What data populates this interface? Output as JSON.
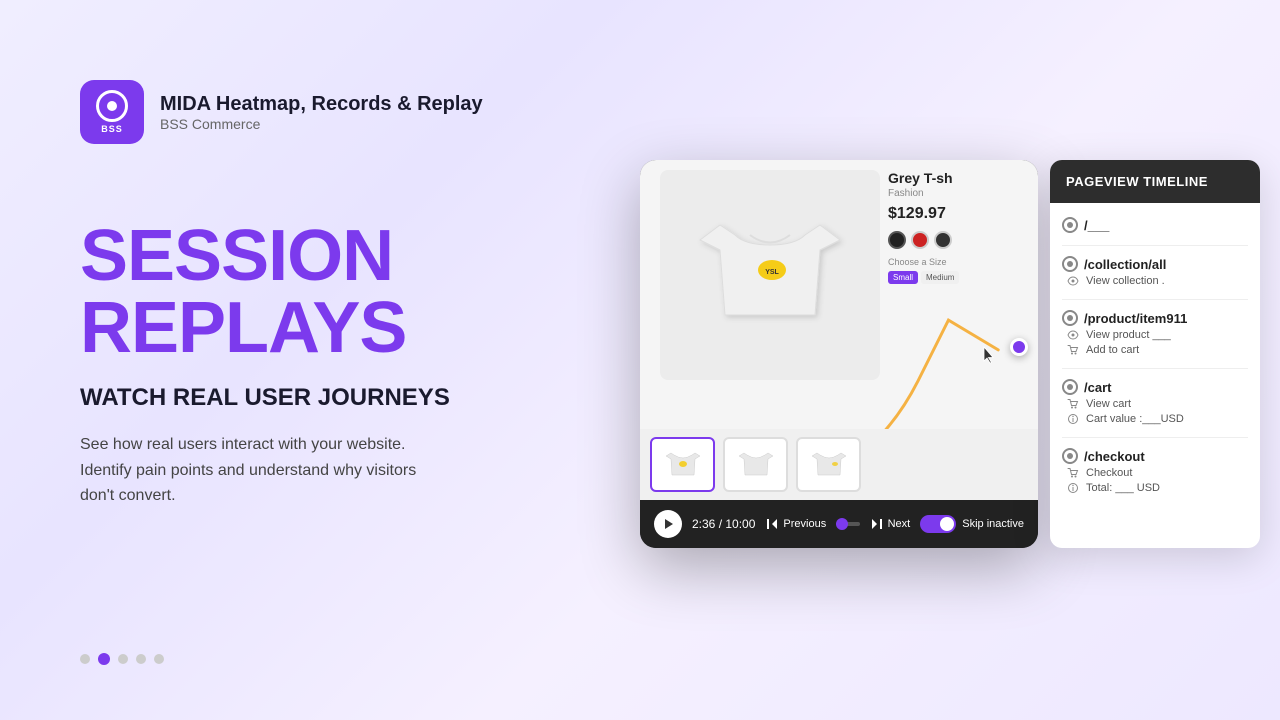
{
  "header": {
    "logo_alt": "MIDA Logo",
    "app_name": "MIDA Heatmap, Records & Replay",
    "company": "BSS Commerce"
  },
  "hero": {
    "main_title": "SESSION REPLAYS",
    "subtitle": "WATCH REAL USER JOURNEYS",
    "description_line1": "See how real users interact with your website.",
    "description_line2": "Identify pain points and understand why visitors",
    "description_line3": "don't convert."
  },
  "video": {
    "product_title": "Grey T-sh",
    "product_category": "Fashion",
    "product_price": "$129.97",
    "time_current": "2:36",
    "time_total": "10:00",
    "time_display": "2:36 / 10:00",
    "prev_label": "Previous",
    "next_label": "Next",
    "skip_label": "Skip inactive"
  },
  "timeline": {
    "header": "PAGEVIEW TIMELINE",
    "items": [
      {
        "route": "/___",
        "subs": []
      },
      {
        "route": "/collection/all",
        "subs": [
          {
            "type": "eye",
            "text": "View collection ."
          }
        ]
      },
      {
        "route": "/product/item911",
        "subs": [
          {
            "type": "eye",
            "text": "View product ___"
          },
          {
            "type": "cart",
            "text": "Add to cart"
          }
        ]
      },
      {
        "route": "/cart",
        "subs": [
          {
            "type": "cart",
            "text": "View cart"
          },
          {
            "type": "text",
            "text": "Cart value :___USD"
          }
        ]
      },
      {
        "route": "/checkout",
        "subs": [
          {
            "type": "cart",
            "text": "Checkout"
          },
          {
            "type": "text",
            "text": "Total: ___ USD"
          }
        ]
      }
    ]
  },
  "dots": {
    "count": 5,
    "active_index": 1
  }
}
